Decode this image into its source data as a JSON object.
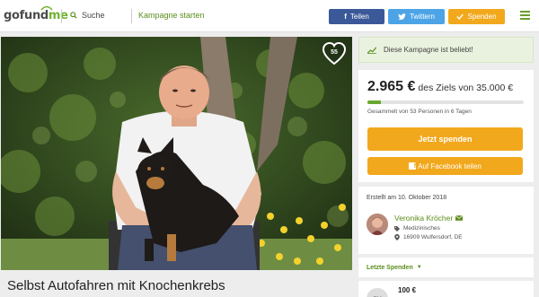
{
  "header": {
    "logo_go": "go",
    "logo_fund": "fund",
    "logo_me": "me",
    "search_label": "Suche",
    "start_label": "Kampagne starten",
    "share_label": "Teilen",
    "tweet_label": "Twittern",
    "donate_label": "Spenden"
  },
  "photo": {
    "heart_count": "55"
  },
  "campaign": {
    "title": "Selbst Autofahren mit Knochenkrebs"
  },
  "sidebar": {
    "popular_text": "Diese Kampagne ist beliebt!",
    "raised": "2.965 €",
    "goal_text": "des Ziels von 35.000 €",
    "progress_fraction": 0.085,
    "collected_text": "Gesammelt von 53 Personen in 6 Tagen",
    "donate_button": "Jetzt spenden",
    "facebook_button": "Auf Facebook teilen",
    "created_text": "Erstellt am 10. Oktober 2018",
    "organizer_name": "Veronika Kröcher",
    "organizer_category": "Medizinisches",
    "organizer_location": "16909 Wulfersdorf, DE",
    "recent_label": "Letzte Spenden",
    "donor_initials": "SH",
    "donation_amount": "100 €"
  },
  "colors": {
    "brand_green": "#71b42f",
    "facebook": "#3b5998",
    "twitter": "#4ca4e6",
    "orange": "#f2a81d"
  }
}
